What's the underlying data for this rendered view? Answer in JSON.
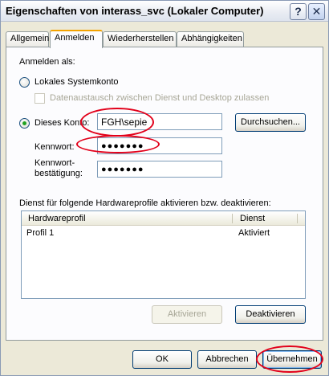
{
  "window": {
    "title": "Eigenschaften von interass_svc (Lokaler Computer)",
    "help_label": "?",
    "close_label": "✕"
  },
  "tabs": [
    {
      "label": "Allgemein",
      "active": false
    },
    {
      "label": "Anmelden",
      "active": true
    },
    {
      "label": "Wiederherstellen",
      "active": false
    },
    {
      "label": "Abhängigkeiten",
      "active": false
    }
  ],
  "logon": {
    "section_label": "Anmelden als:",
    "local_system_label": "Lokales Systemkonto",
    "desktop_interact_label": "Datenaustausch zwischen Dienst und Desktop zulassen",
    "this_account_label": "Dieses Konto:",
    "account_value": "FGH\\sepie",
    "browse_label": "Durchsuchen...",
    "password_label": "Kennwort:",
    "password_value": "●●●●●●●",
    "confirm_label_line1": "Kennwort-",
    "confirm_label_line2": "bestätigung:",
    "confirm_value": "●●●●●●●"
  },
  "profiles": {
    "section_label": "Dienst für folgende Hardwareprofile aktivieren bzw. deaktivieren:",
    "columns": [
      "Hardwareprofil",
      "Dienst"
    ],
    "rows": [
      {
        "profile": "Profil 1",
        "service": "Aktiviert"
      }
    ],
    "enable_label": "Aktivieren",
    "disable_label": "Deaktivieren"
  },
  "footer": {
    "ok_label": "OK",
    "cancel_label": "Abbrechen",
    "apply_label": "Übernehmen"
  },
  "colors": {
    "annotation": "#e2001a",
    "active_tab_accent": "#f4a300"
  }
}
